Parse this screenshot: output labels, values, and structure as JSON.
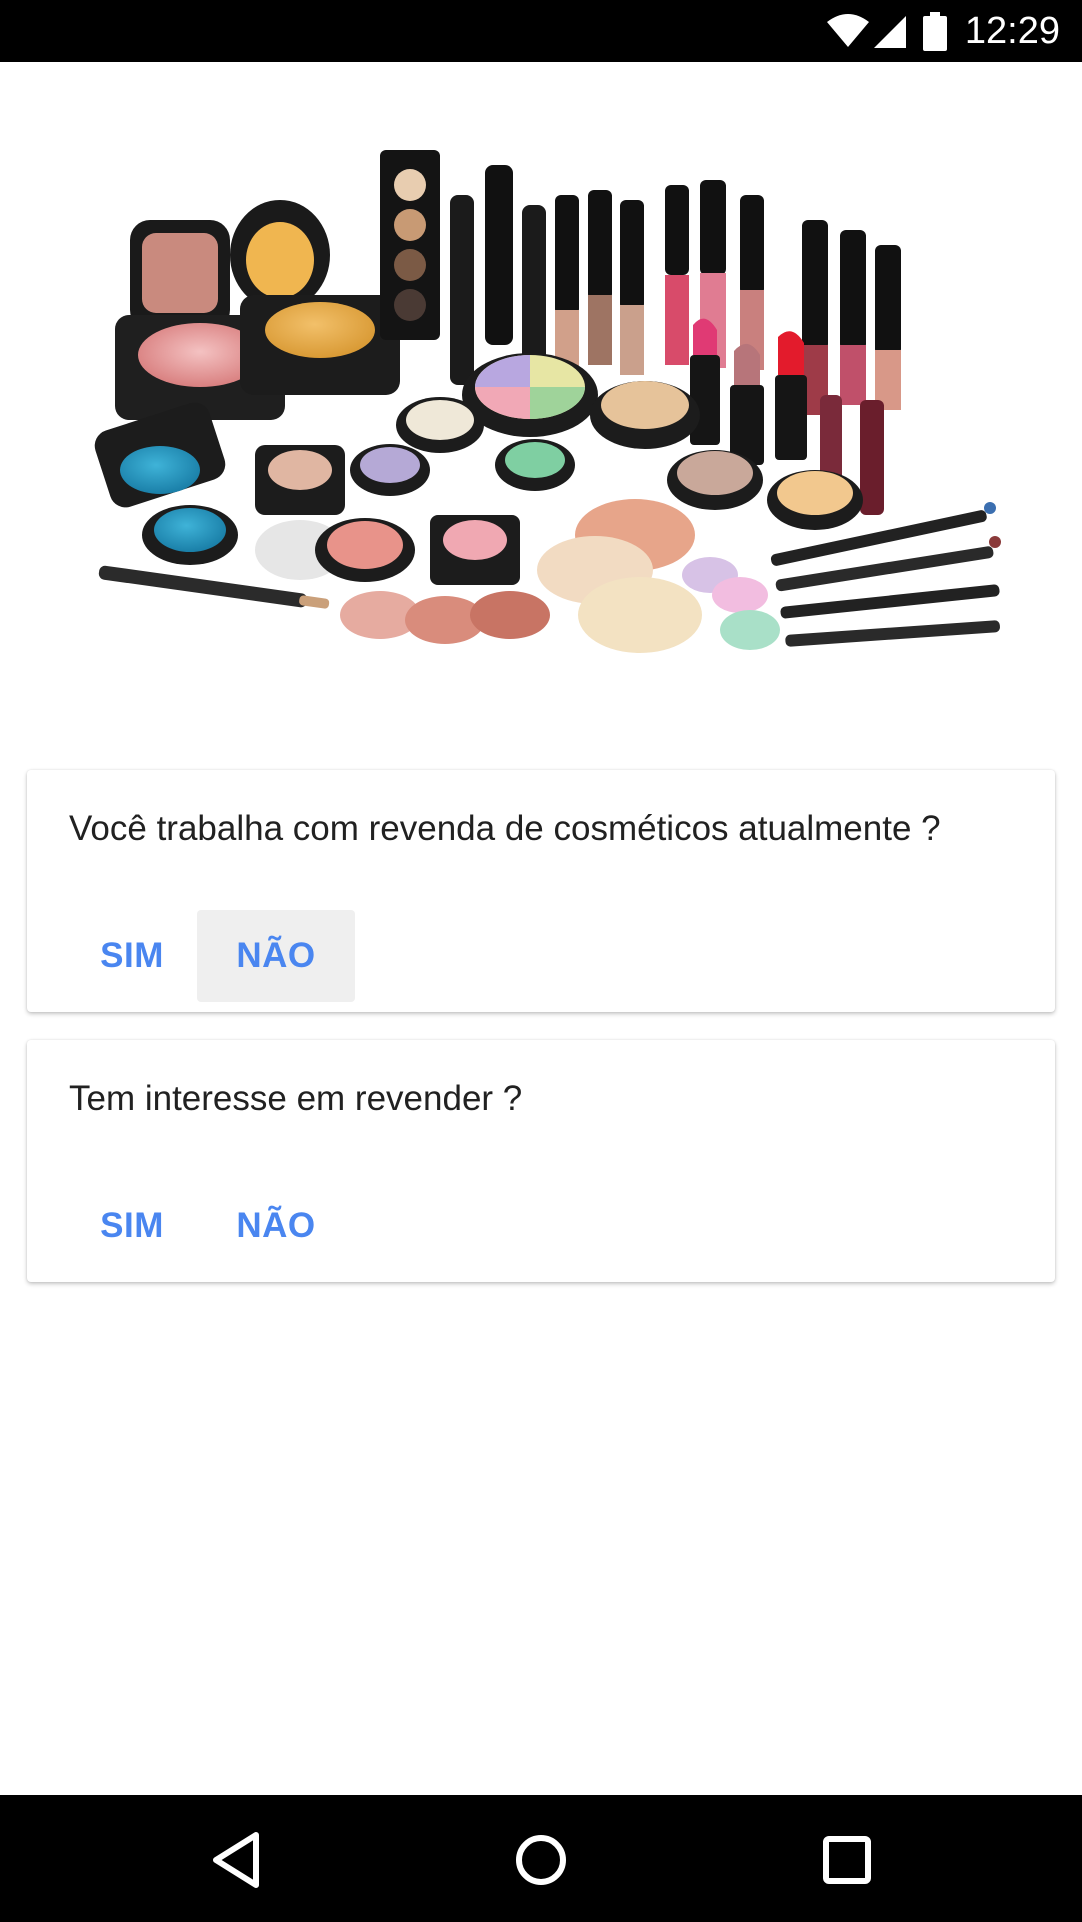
{
  "status_bar": {
    "time": "12:29",
    "icons": [
      "wifi-icon",
      "signal-icon",
      "battery-icon"
    ]
  },
  "hero": {
    "icon": "cosmetics-makeup-image"
  },
  "questions": [
    {
      "text": "Você trabalha com revenda de cosméticos atualmente ?",
      "yes_label": "SIM",
      "no_label": "NÃO",
      "pressed": "NÃO"
    },
    {
      "text": "Tem interesse em revender ?",
      "yes_label": "SIM",
      "no_label": "NÃO"
    }
  ],
  "nav_bar": {
    "icons": [
      "back-icon",
      "home-icon",
      "recents-icon"
    ]
  },
  "colors": {
    "accent": "#4a86f0",
    "text": "#212121",
    "bars": "#000000",
    "pressed_bg": "#efefef"
  }
}
